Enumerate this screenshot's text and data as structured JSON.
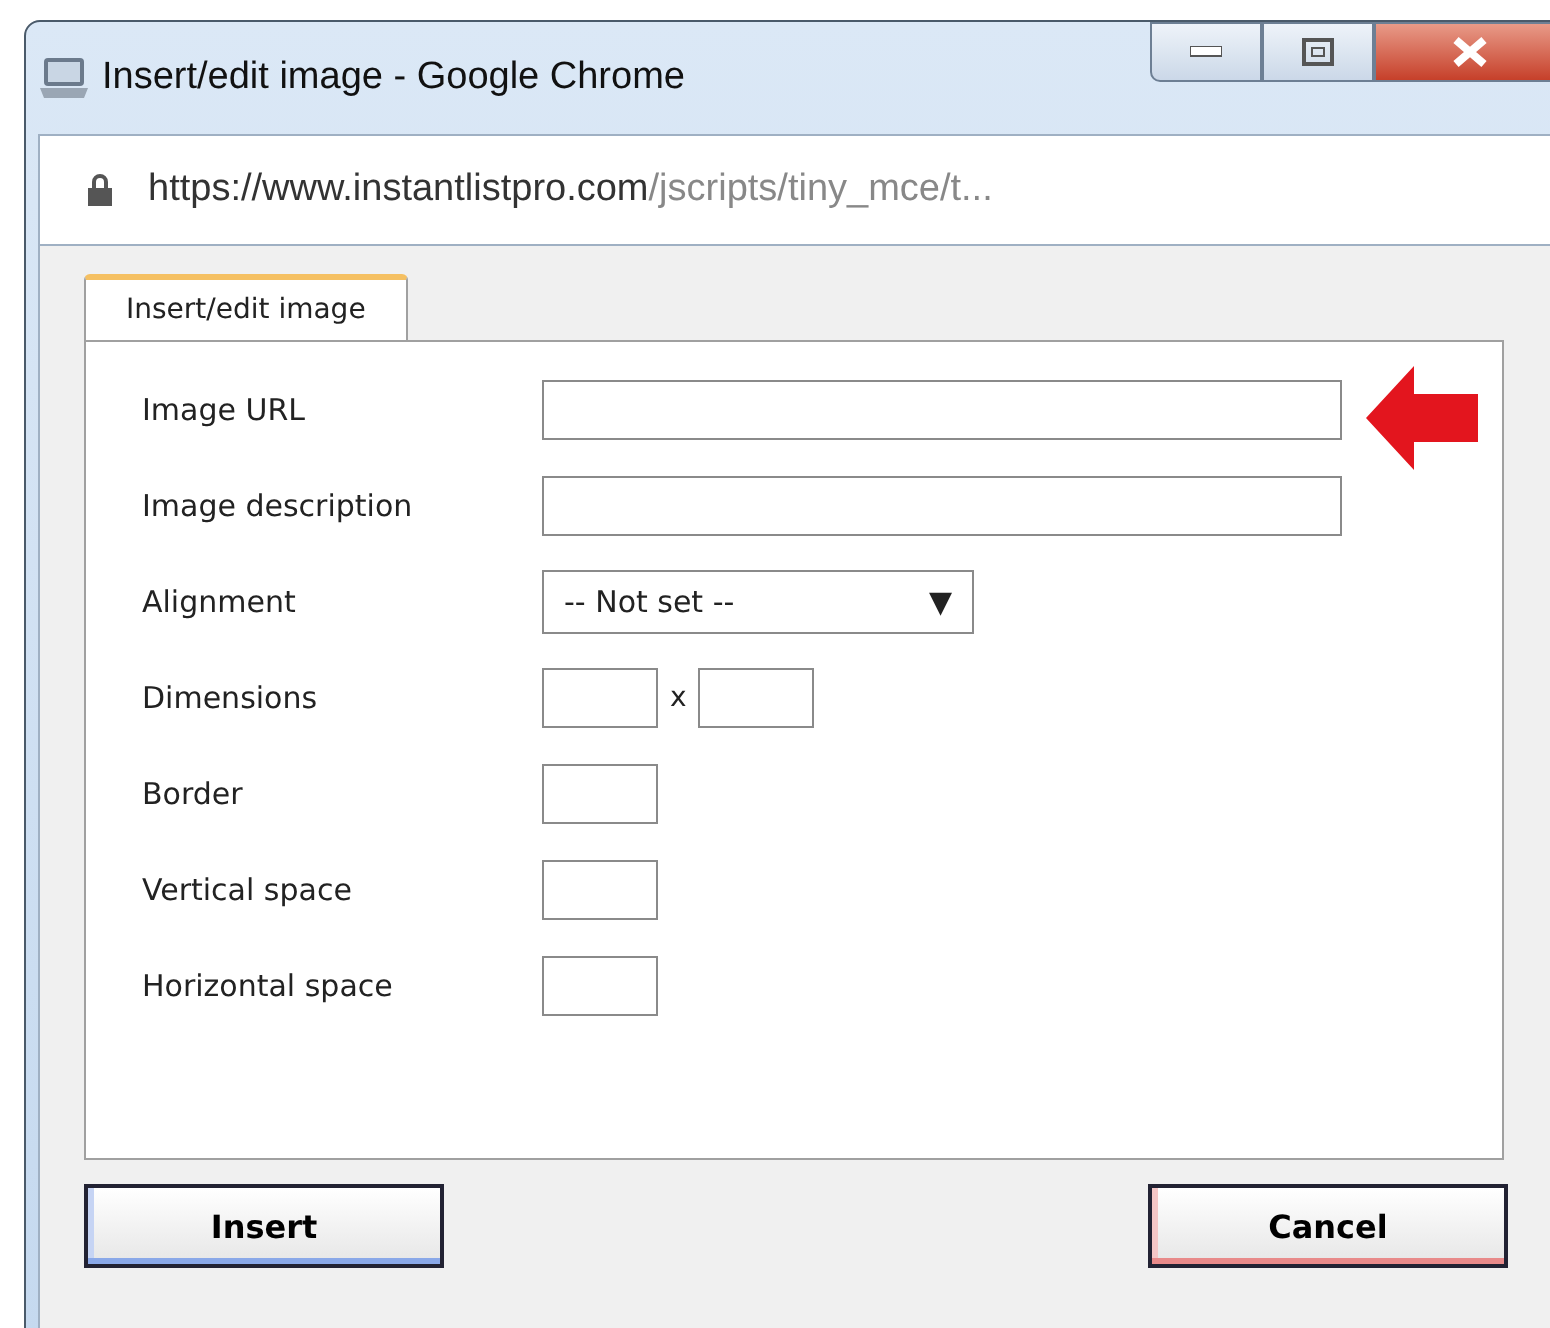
{
  "window": {
    "title": "Insert/edit image - Google Chrome"
  },
  "address_bar": {
    "host": "https://www.instantlistpro.com",
    "path": "/jscripts/tiny_mce/t..."
  },
  "tabs": [
    {
      "label": "Insert/edit image",
      "selected": true
    }
  ],
  "fields": [
    {
      "kind": "wide",
      "label": "Image URL",
      "highlighted": true
    },
    {
      "kind": "wide",
      "label": "Image description",
      "highlighted": false
    },
    {
      "kind": "select",
      "label": "Alignment",
      "value": "-- Not set --",
      "arrow": "▼"
    },
    {
      "kind": "dims",
      "label": "Dimensions",
      "separator": "x"
    },
    {
      "kind": "small",
      "label": "Border"
    },
    {
      "kind": "small",
      "label": "Vertical space"
    },
    {
      "kind": "small",
      "label": "Horizontal space"
    }
  ],
  "buttons": [
    {
      "label": "Insert",
      "kind": "primary"
    },
    {
      "label": "Cancel",
      "kind": "cancel"
    }
  ]
}
